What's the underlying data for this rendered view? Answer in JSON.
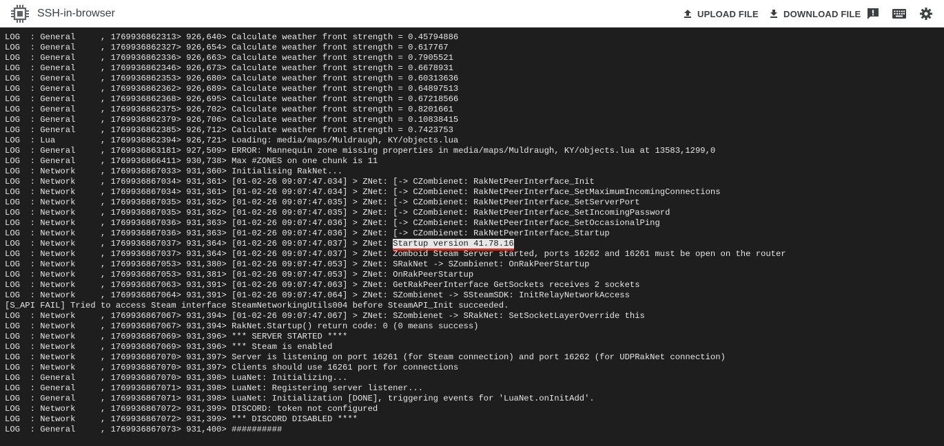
{
  "window": {
    "title": "SSH-in-browser",
    "icons": {
      "app": "chip-icon",
      "upload": "upload-icon",
      "download": "download-icon",
      "feedback": "feedback-icon",
      "keyboard": "keyboard-icon",
      "settings": "gear-icon"
    }
  },
  "toolbar": {
    "upload_label": "UPLOAD FILE",
    "download_label": "DOWNLOAD FILE"
  },
  "colors": {
    "terminal_bg": "#1e1e1e",
    "terminal_fg": "#e6e6e6",
    "highlight_bg": "#e6e6e6",
    "highlight_underline": "#d93025",
    "toolbar_bg": "#ffffff"
  },
  "terminal": {
    "lines": [
      "LOG  : General     , 1769936862313> 926,640> Calculate weather front strength = 0.45794886",
      "LOG  : General     , 1769936862327> 926,654> Calculate weather front strength = 0.617767",
      "LOG  : General     , 1769936862336> 926,663> Calculate weather front strength = 0.7905521",
      "LOG  : General     , 1769936862346> 926,673> Calculate weather front strength = 0.6678931",
      "LOG  : General     , 1769936862353> 926,680> Calculate weather front strength = 0.60313636",
      "LOG  : General     , 1769936862362> 926,689> Calculate weather front strength = 0.64897513",
      "LOG  : General     , 1769936862368> 926,695> Calculate weather front strength = 0.67218566",
      "LOG  : General     , 1769936862375> 926,702> Calculate weather front strength = 0.8201661",
      "LOG  : General     , 1769936862379> 926,706> Calculate weather front strength = 0.10838415",
      "LOG  : General     , 1769936862385> 926,712> Calculate weather front strength = 0.7423753",
      "LOG  : Lua         , 1769936862394> 926,721> Loading: media/maps/Muldraugh, KY/objects.lua",
      "LOG  : General     , 1769936863181> 927,509> ERROR: Mannequin zone missing properties in media/maps/Muldraugh, KY/objects.lua at 13583,1299,0",
      "LOG  : General     , 1769936866411> 930,738> Max #ZONES on one chunk is 11",
      "LOG  : Network     , 1769936867033> 931,360> Initialising RakNet...",
      "LOG  : Network     , 1769936867034> 931,361> [01-02-26 09:07:47.034] > ZNet: [-> CZombienet: RakNetPeerInterface_Init",
      "LOG  : Network     , 1769936867034> 931,361> [01-02-26 09:07:47.034] > ZNet: [-> CZombienet: RakNetPeerInterface_SetMaximumIncomingConnections",
      "LOG  : Network     , 1769936867035> 931,362> [01-02-26 09:07:47.035] > ZNet: [-> CZombienet: RakNetPeerInterface_SetServerPort",
      "LOG  : Network     , 1769936867035> 931,362> [01-02-26 09:07:47.035] > ZNet: [-> CZombienet: RakNetPeerInterface_SetIncomingPassword",
      "LOG  : Network     , 1769936867036> 931,363> [01-02-26 09:07:47.036] > ZNet: [-> CZombienet: RakNetPeerInterface_SetOccasionalPing",
      "LOG  : Network     , 1769936867036> 931,363> [01-02-26 09:07:47.036] > ZNet: [-> CZombienet: RakNetPeerInterface_Startup",
      "LOG  : Network     , 1769936867037> 931,364> [01-02-26 09:07:47.037] > ZNet: ",
      "LOG  : Network     , 1769936867037> 931,364> [01-02-26 09:07:47.037] > ZNet: Zomboid Steam Server started, ports 16262 and 16261 must be open on the router",
      "LOG  : Network     , 1769936867053> 931,380> [01-02-26 09:07:47.053] > ZNet: SRakNet -> SZombienet: OnRakPeerStartup",
      "LOG  : Network     , 1769936867053> 931,381> [01-02-26 09:07:47.053] > ZNet: OnRakPeerStartup",
      "LOG  : Network     , 1769936867063> 931,391> [01-02-26 09:07:47.063] > ZNet: GetRakPeerInterface GetSockets receives 2 sockets",
      "LOG  : Network     , 1769936867064> 931,391> [01-02-26 09:07:47.064] > ZNet: SZombienet -> SSteamSDK: InitRelayNetworkAccess",
      "[S_API FAIL] Tried to access Steam interface SteamNetworkingUtils004 before SteamAPI_Init succeeded.",
      "LOG  : Network     , 1769936867067> 931,394> [01-02-26 09:07:47.067] > ZNet: SZombienet -> SRakNet: SetSocketLayerOverride this",
      "LOG  : Network     , 1769936867067> 931,394> RakNet.Startup() return code: 0 (0 means success)",
      "LOG  : Network     , 1769936867069> 931,396> *** SERVER STARTED ****",
      "LOG  : Network     , 1769936867069> 931,396> *** Steam is enabled",
      "LOG  : Network     , 1769936867070> 931,397> Server is listening on port 16261 (for Steam connection) and port 16262 (for UDPRakNet connection)",
      "LOG  : Network     , 1769936867070> 931,397> Clients should use 16261 port for connections",
      "LOG  : General     , 1769936867070> 931,398> LuaNet: Initializing...",
      "LOG  : General     , 1769936867071> 931,398> LuaNet: Registering server listener...",
      "LOG  : General     , 1769936867071> 931,398> LuaNet: Initialization [DONE], triggering events for 'LuaNet.onInitAdd'.",
      "LOG  : Network     , 1769936867072> 931,399> DISCORD: token not configured",
      "LOG  : Network     , 1769936867072> 931,399> *** DISCORD DISABLED ****",
      "LOG  : General     , 1769936867073> 931,400> ##########"
    ],
    "highlight": {
      "line_index": 20,
      "text": "Startup version 41.78.16"
    }
  }
}
